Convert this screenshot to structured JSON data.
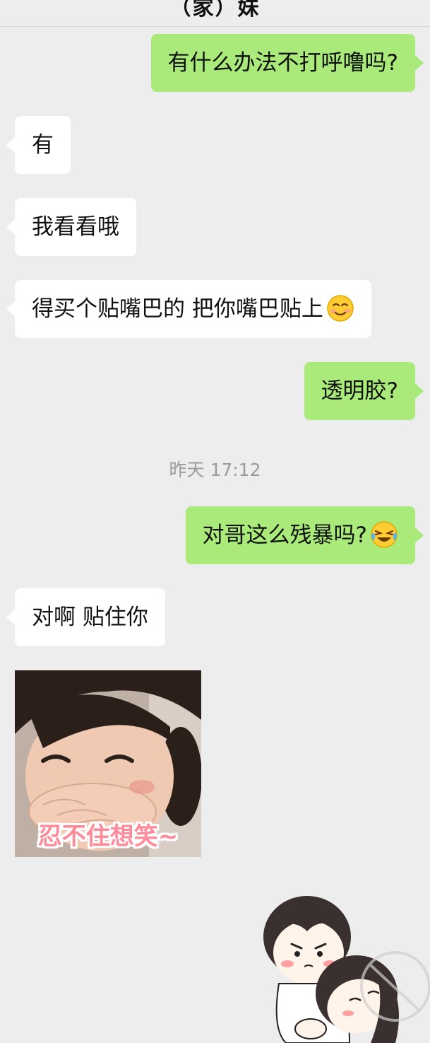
{
  "header": {
    "title": "（家）妹"
  },
  "messages": [
    {
      "id": "m1",
      "side": "out",
      "text": "有什么办法不打呼噜吗?"
    },
    {
      "id": "m2",
      "side": "in",
      "text": "有"
    },
    {
      "id": "m3",
      "side": "in",
      "text": "我看看哦"
    },
    {
      "id": "m4",
      "side": "in",
      "text": "得买个贴嘴巴的 把你嘴巴贴上",
      "emoji": "smiling-blush-emoji"
    },
    {
      "id": "m5",
      "side": "out",
      "text": "透明胶?"
    },
    {
      "id": "m6",
      "side": "out",
      "text": "对哥这么残暴吗?",
      "emoji": "laughing-tears-emoji"
    },
    {
      "id": "m7",
      "side": "in",
      "text": "对啊 贴住你"
    }
  ],
  "timestamp": "昨天 17:12",
  "stickers": {
    "photo_caption": "忍不住想笑~",
    "photo_icon": "child-laughing-sticker",
    "cartoon_icon": "couple-cartoon-sticker"
  },
  "colors": {
    "background": "#ededed",
    "outgoing_bubble": "#a9ea7a",
    "incoming_bubble": "#ffffff",
    "timestamp_text": "#9b9b9b",
    "sticker_caption": "#ff8a9a"
  }
}
